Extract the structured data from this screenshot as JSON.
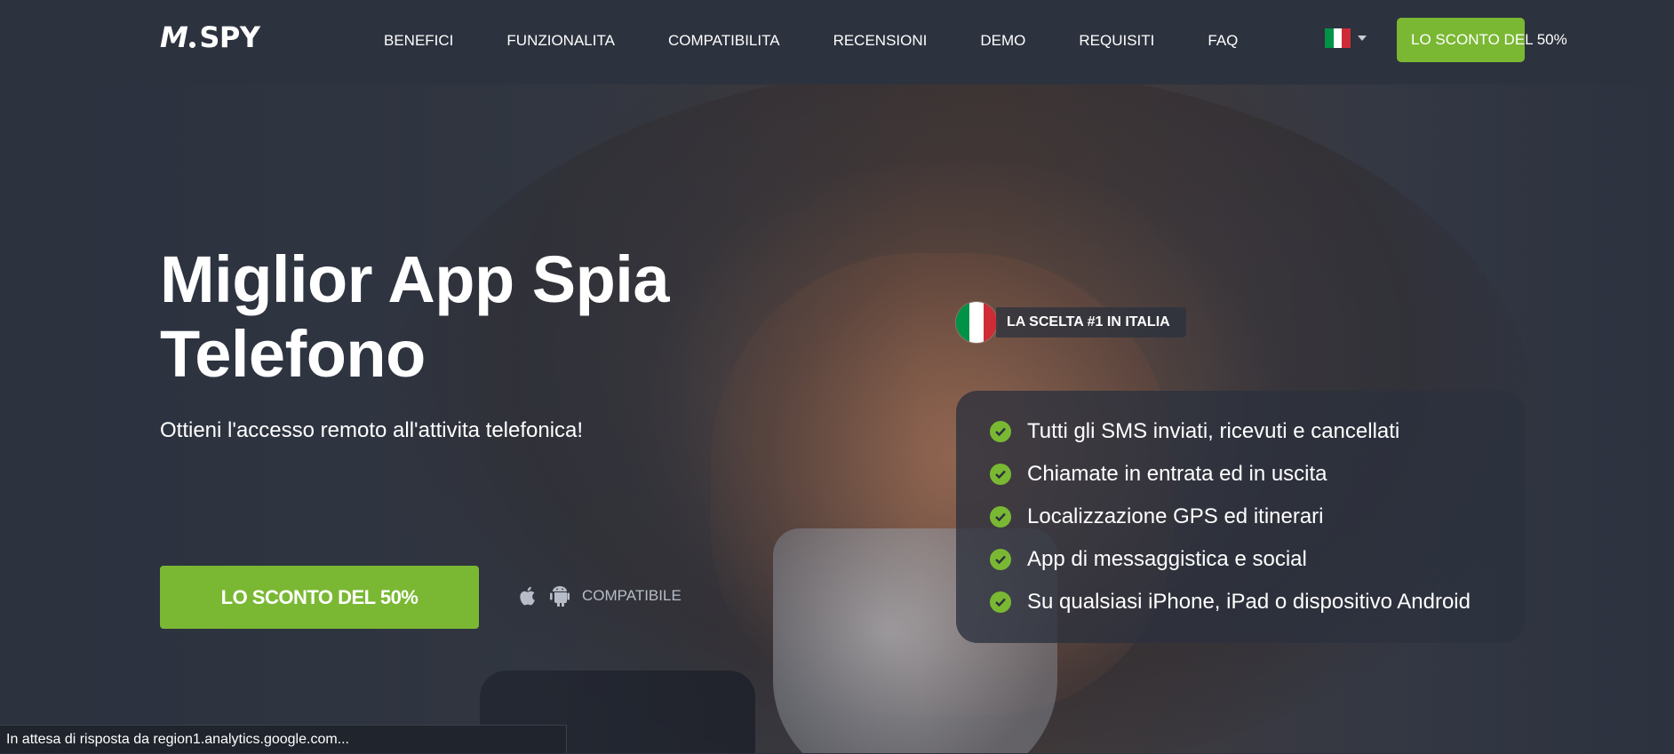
{
  "nav": {
    "logo_text": "SPY",
    "logo_mark": "M",
    "items": [
      "BENEFICI",
      "FUNZIONALITA",
      "COMPATIBILITA",
      "RECENSIONI",
      "DEMO",
      "REQUISITI",
      "FAQ"
    ],
    "language_icon": "italy-flag-icon",
    "cta_label": "LO SCONTO DEL 50%"
  },
  "hero": {
    "title_line1": "Miglior App Spia",
    "title_line2": "Telefono",
    "subtitle": "Ottieni l'accesso remoto all'attivita telefonica!",
    "cta_label": "LO SCONTO DEL 50%",
    "compat_label": "COMPATIBILE",
    "compat_icons": [
      "apple-icon",
      "android-icon"
    ],
    "badge_text": "LA SCELTA #1 IN ITALIA",
    "features": [
      "Tutti gli SMS inviati, ricevuti e cancellati",
      "Chiamate in entrata ed in uscita",
      "Localizzazione GPS ed itinerari",
      "App di messaggistica e social",
      "Su qualsiasi iPhone, iPad o dispositivo Android"
    ]
  },
  "status_bar": {
    "text": "In attesa di risposta da region1.analytics.google.com..."
  },
  "colors": {
    "accent": "#7ab833",
    "nav_bg": "#2c323e",
    "flag_green": "#009246",
    "flag_white": "#ffffff",
    "flag_red": "#ce2b37"
  }
}
